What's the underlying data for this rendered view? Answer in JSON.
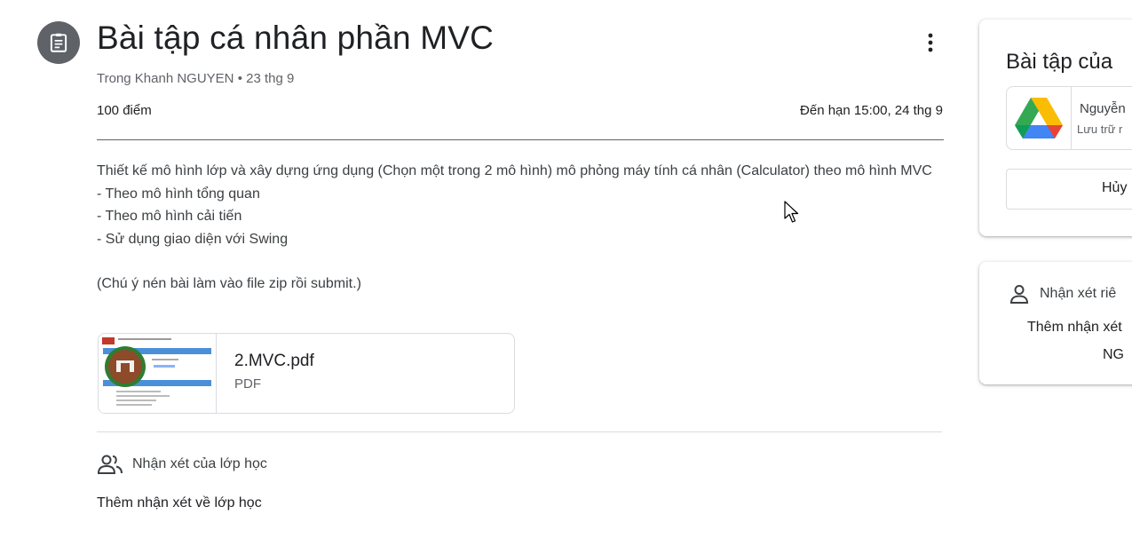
{
  "assignment": {
    "title": "Bài tập cá nhân phần MVC",
    "author": "Trong Khanh NGUYEN",
    "separator": "•",
    "posted_date": "23 thg 9",
    "points": "100 điểm",
    "due": "Đến hạn 15:00, 24 thg 9",
    "description": [
      "Thiết kế mô hình lớp và xây dựng ứng dụng (Chọn một trong 2 mô hình) mô phỏng máy tính cá nhân (Calculator) theo mô hình MVC",
      "- Theo mô hình tổng quan",
      "- Theo mô hình cải tiến",
      "- Sử dụng giao diện với Swing"
    ],
    "note": "(Chú ý nén bài làm vào file zip rồi submit.)"
  },
  "attachment": {
    "name": "2.MVC.pdf",
    "type": "PDF"
  },
  "class_comments": {
    "label": "Nhận xét của lớp học",
    "add_label": "Thêm nhận xét về lớp học"
  },
  "your_work": {
    "title": "Bài tập của",
    "file_owner": "Nguyễn",
    "file_source": "Lưu trữ r",
    "unsubmit_label": "Hủy"
  },
  "private_comments": {
    "label": "Nhận xét riê",
    "add_label": "Thêm nhận xét",
    "name_fragment": "NG"
  },
  "icons": {
    "assignment": "assignment-icon",
    "more": "more-vert-icon",
    "class_comments": "people-icon",
    "private_comments": "person-icon",
    "drive": "google-drive-icon"
  },
  "colors": {
    "icon_circle": "#5f6368",
    "drive_green": "#34a853",
    "drive_yellow": "#fbbc04",
    "drive_blue": "#4285f4"
  }
}
